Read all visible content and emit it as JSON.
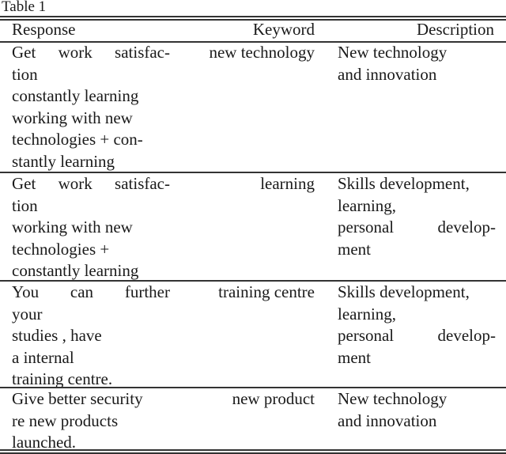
{
  "caption": "Table 1",
  "table": {
    "headers": {
      "response": "Response",
      "keyword": "Keyword",
      "description": "Description"
    },
    "rows": [
      {
        "response_lines": [
          [
            "Get",
            "work",
            "satisfac-"
          ],
          [
            "tion"
          ],
          [
            "constantly learning"
          ],
          [
            "working with new"
          ],
          [
            "technologies + con-"
          ],
          [
            "stantly learning"
          ]
        ],
        "keyword": "new technology",
        "description_lines": [
          [
            "New technology"
          ],
          [
            "and innovation"
          ]
        ]
      },
      {
        "response_lines": [
          [
            "Get",
            "work",
            "satisfac-"
          ],
          [
            "tion"
          ],
          [
            "working with new"
          ],
          [
            "technologies +"
          ],
          [
            "constantly learning"
          ]
        ],
        "keyword": "learning",
        "description_lines": [
          [
            "Skills development,"
          ],
          [
            "learning,"
          ],
          [
            "personal",
            "develop-"
          ],
          [
            "ment"
          ]
        ]
      },
      {
        "response_lines": [
          [
            "You",
            "can",
            "further"
          ],
          [
            "your"
          ],
          [
            "studies , have"
          ],
          [
            "a internal"
          ],
          [
            "training centre."
          ]
        ],
        "keyword": "training centre",
        "description_lines": [
          [
            "Skills development,"
          ],
          [
            "learning,"
          ],
          [
            "personal",
            "develop-"
          ],
          [
            "ment"
          ]
        ]
      },
      {
        "response_lines": [
          [
            "Give better security"
          ],
          [
            "re new products"
          ],
          [
            "launched."
          ]
        ],
        "keyword": "new product",
        "description_lines": [
          [
            "New technology"
          ],
          [
            "and innovation"
          ]
        ]
      }
    ]
  }
}
